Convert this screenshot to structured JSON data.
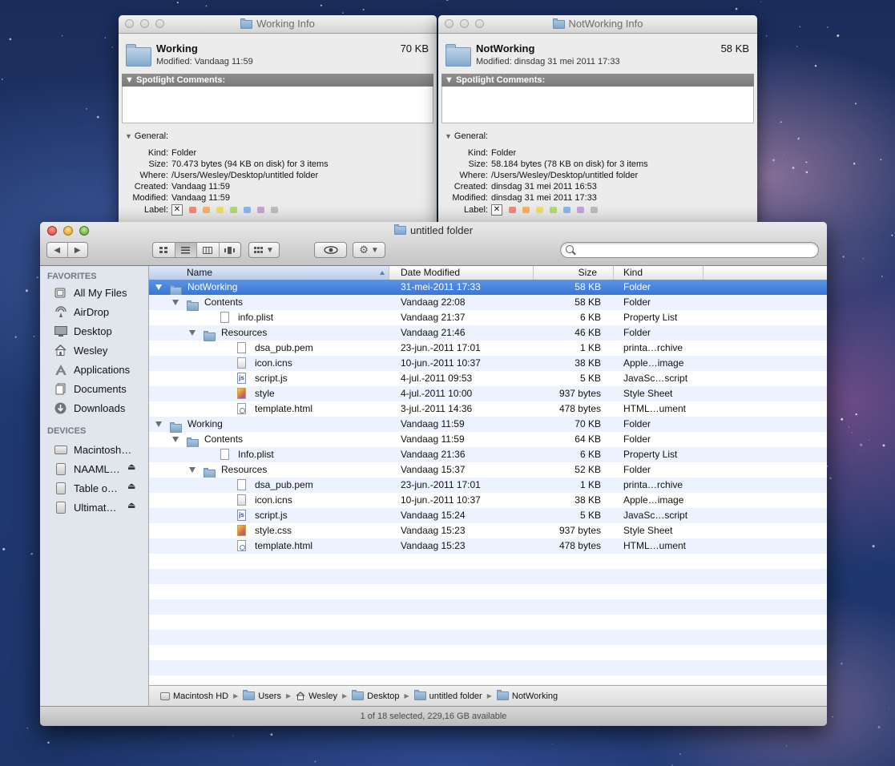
{
  "info_windows": [
    {
      "title": "Working Info",
      "name": "Working",
      "size": "70 KB",
      "modified": "Modified: Vandaag 11:59",
      "spotlight_label": "Spotlight Comments:",
      "general_label": "General:",
      "rows": [
        {
          "key": "Kind:",
          "value": "Folder"
        },
        {
          "key": "Size:",
          "value": "70.473 bytes (94 KB on disk) for 3 items"
        },
        {
          "key": "Where:",
          "value": "/Users/Wesley/Desktop/untitled folder"
        },
        {
          "key": "Created:",
          "value": "Vandaag 11:59"
        },
        {
          "key": "Modified:",
          "value": "Vandaag 11:59"
        }
      ],
      "label_key": "Label:",
      "label_none": "✕"
    },
    {
      "title": "NotWorking Info",
      "name": "NotWorking",
      "size": "58 KB",
      "modified": "Modified: dinsdag 31 mei 2011 17:33",
      "spotlight_label": "Spotlight Comments:",
      "general_label": "General:",
      "rows": [
        {
          "key": "Kind:",
          "value": "Folder"
        },
        {
          "key": "Size:",
          "value": "58.184 bytes (78 KB on disk) for 3 items"
        },
        {
          "key": "Where:",
          "value": "/Users/Wesley/Desktop/untitled folder"
        },
        {
          "key": "Created:",
          "value": "dinsdag 31 mei 2011 16:53"
        },
        {
          "key": "Modified:",
          "value": "dinsdag 31 mei 2011 17:33"
        }
      ],
      "label_key": "Label:",
      "label_none": "✕"
    }
  ],
  "label_colors": [
    "#f08a7e",
    "#f5b266",
    "#f1de6d",
    "#b3dc73",
    "#8bb8f0",
    "#c7a5dc",
    "#bdbdbd"
  ],
  "finder": {
    "title": "untitled folder",
    "sidebar": {
      "favorites_label": "FAVORITES",
      "favorites": [
        {
          "label": "All My Files",
          "icon": "all-files-icon"
        },
        {
          "label": "AirDrop",
          "icon": "airdrop-icon"
        },
        {
          "label": "Desktop",
          "icon": "desktop-icon"
        },
        {
          "label": "Wesley",
          "icon": "home-icon"
        },
        {
          "label": "Applications",
          "icon": "applications-icon"
        },
        {
          "label": "Documents",
          "icon": "documents-icon"
        },
        {
          "label": "Downloads",
          "icon": "downloads-icon"
        }
      ],
      "devices_label": "DEVICES",
      "devices": [
        {
          "label": "Macintosh…",
          "eject": ""
        },
        {
          "label": "NAAML…",
          "eject": "⏏"
        },
        {
          "label": "Table o…",
          "eject": "⏏"
        },
        {
          "label": "Ultimat…",
          "eject": "⏏"
        }
      ]
    },
    "columns": {
      "name": "Name",
      "date": "Date Modified",
      "size": "Size",
      "kind": "Kind"
    },
    "rows": [
      {
        "name": "NotWorking",
        "date": "31-mei-2011 17:33",
        "size": "58 KB",
        "kind": "Folder",
        "level": 0,
        "type": "folder",
        "expanded": true,
        "selected": true
      },
      {
        "name": "Contents",
        "date": "Vandaag 22:08",
        "size": "58 KB",
        "kind": "Folder",
        "level": 1,
        "type": "folder",
        "expanded": true
      },
      {
        "name": "info.plist",
        "date": "Vandaag 21:37",
        "size": "6 KB",
        "kind": "Property List",
        "level": 2,
        "type": "doc"
      },
      {
        "name": "Resources",
        "date": "Vandaag 21:46",
        "size": "46 KB",
        "kind": "Folder",
        "level": 2,
        "type": "folder",
        "expanded": true
      },
      {
        "name": "dsa_pub.pem",
        "date": "23-jun.-2011 17:01",
        "size": "1 KB",
        "kind": "printa…rchive",
        "level": 3,
        "type": "doc"
      },
      {
        "name": "icon.icns",
        "date": "10-jun.-2011 10:37",
        "size": "38 KB",
        "kind": "Apple…image",
        "level": 3,
        "type": "icns"
      },
      {
        "name": "script.js",
        "date": "4-jul.-2011 09:53",
        "size": "5 KB",
        "kind": "JavaSc…script",
        "level": 3,
        "type": "js"
      },
      {
        "name": "style",
        "date": "4-jul.-2011 10:00",
        "size": "937 bytes",
        "kind": "Style Sheet",
        "level": 3,
        "type": "css"
      },
      {
        "name": "template.html",
        "date": "3-jul.-2011 14:36",
        "size": "478 bytes",
        "kind": "HTML…ument",
        "level": 3,
        "type": "html"
      },
      {
        "name": "Working",
        "date": "Vandaag 11:59",
        "size": "70 KB",
        "kind": "Folder",
        "level": 0,
        "type": "folder",
        "expanded": true
      },
      {
        "name": "Contents",
        "date": "Vandaag 11:59",
        "size": "64 KB",
        "kind": "Folder",
        "level": 1,
        "type": "folder",
        "expanded": true
      },
      {
        "name": "Info.plist",
        "date": "Vandaag 21:36",
        "size": "6 KB",
        "kind": "Property List",
        "level": 2,
        "type": "doc"
      },
      {
        "name": "Resources",
        "date": "Vandaag 15:37",
        "size": "52 KB",
        "kind": "Folder",
        "level": 2,
        "type": "folder",
        "expanded": true
      },
      {
        "name": "dsa_pub.pem",
        "date": "23-jun.-2011 17:01",
        "size": "1 KB",
        "kind": "printa…rchive",
        "level": 3,
        "type": "doc"
      },
      {
        "name": "icon.icns",
        "date": "10-jun.-2011 10:37",
        "size": "38 KB",
        "kind": "Apple…image",
        "level": 3,
        "type": "icns"
      },
      {
        "name": "script.js",
        "date": "Vandaag 15:24",
        "size": "5 KB",
        "kind": "JavaSc…script",
        "level": 3,
        "type": "js"
      },
      {
        "name": "style.css",
        "date": "Vandaag 15:23",
        "size": "937 bytes",
        "kind": "Style Sheet",
        "level": 3,
        "type": "css"
      },
      {
        "name": "template.html",
        "date": "Vandaag 15:23",
        "size": "478 bytes",
        "kind": "HTML…ument",
        "level": 3,
        "type": "html"
      }
    ],
    "path": [
      {
        "label": "Macintosh HD",
        "icon": "hard-disk-icon"
      },
      {
        "label": "Users",
        "icon": "folder-icon"
      },
      {
        "label": "Wesley",
        "icon": "home-icon"
      },
      {
        "label": "Desktop",
        "icon": "folder-icon"
      },
      {
        "label": "untitled folder",
        "icon": "folder-icon"
      },
      {
        "label": "NotWorking",
        "icon": "folder-icon"
      }
    ],
    "status": "1 of 18 selected, 229,16 GB available"
  }
}
